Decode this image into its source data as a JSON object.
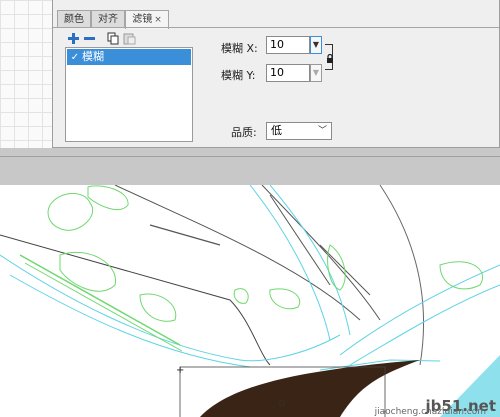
{
  "tabs": [
    {
      "label": "颜色",
      "active": false
    },
    {
      "label": "对齐",
      "active": false
    },
    {
      "label": "滤镜",
      "active": true,
      "close": "×"
    }
  ],
  "toolbar": {
    "add_icon": "add-filter-icon",
    "remove_icon": "remove-filter-icon",
    "copy_icon": "copy-icon",
    "paste_icon": "paste-icon"
  },
  "filters": [
    {
      "label": "模糊",
      "checked": true
    }
  ],
  "properties": {
    "blur_x_label": "模糊 X:",
    "blur_x_value": "10",
    "blur_y_label": "模糊 Y:",
    "blur_y_value": "10",
    "lock_icon": "lock-icon",
    "quality_label": "品质:",
    "quality_value": "低"
  },
  "watermark": {
    "text": "jb51.net",
    "sub": "jiaocheng.chazidian.com"
  },
  "colors": {
    "accent": "#3b8fd8",
    "panel": "#efefef",
    "outline_cyan": "#5fd3e6",
    "outline_green": "#6fd86f",
    "dark": "#3a2416"
  }
}
